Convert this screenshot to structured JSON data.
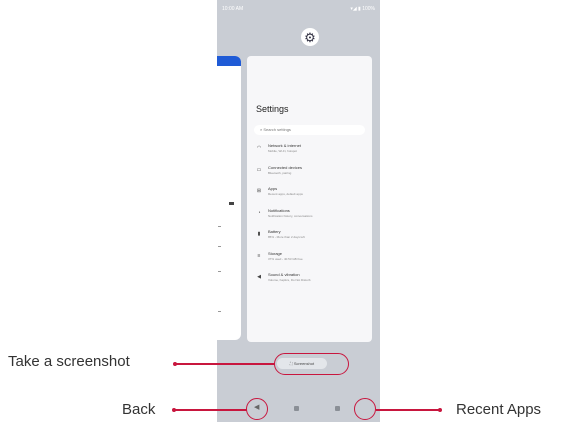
{
  "phone": {
    "status": {
      "time": "10:00 AM",
      "icons": "▾◢ ▮ 100%"
    },
    "settings_icon": "gear-icon",
    "settings": {
      "title": "Settings",
      "search_placeholder": "Search settings",
      "items": [
        {
          "icon": "wifi-icon",
          "title": "Network & internet",
          "subtitle": "Mobile, Wi-Fi, hotspot"
        },
        {
          "icon": "devices-icon",
          "title": "Connected devices",
          "subtitle": "Bluetooth, pairing"
        },
        {
          "icon": "apps-icon",
          "title": "Apps",
          "subtitle": "Recent apps, default apps"
        },
        {
          "icon": "bell-icon",
          "title": "Notifications",
          "subtitle": "Notification history, conversations"
        },
        {
          "icon": "battery-icon",
          "title": "Battery",
          "subtitle": "85% - More than 2 days left"
        },
        {
          "icon": "storage-icon",
          "title": "Storage",
          "subtitle": "37% used - 40.53 GB free"
        },
        {
          "icon": "sound-icon",
          "title": "Sound & vibration",
          "subtitle": "Volume, haptics, Do Not Disturb"
        }
      ]
    },
    "screenshot_button": "Screenshot"
  },
  "annotations": {
    "screenshot": "Take a screenshot",
    "back": "Back",
    "recent": "Recent Apps"
  },
  "colors": {
    "accent": "#c8163e",
    "phone_bg": "#c9cdd4",
    "prev_app_bar": "#1f5bd6"
  }
}
